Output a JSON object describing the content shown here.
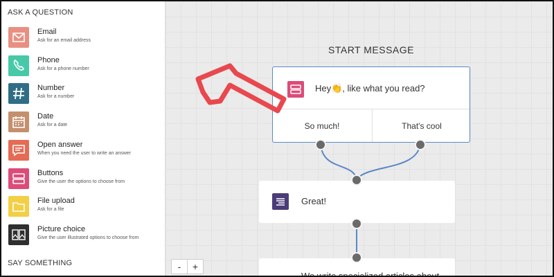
{
  "sidebar": {
    "section_ask": "ASK A QUESTION",
    "section_say": "SAY SOMETHING",
    "items": [
      {
        "title": "Email",
        "desc": "Ask for an email address",
        "icon": "envelope-icon",
        "color": "#e98f82"
      },
      {
        "title": "Phone",
        "desc": "Ask for a phone number",
        "icon": "phone-icon",
        "color": "#47c9a8"
      },
      {
        "title": "Number",
        "desc": "Ask for a number",
        "icon": "hash-icon",
        "color": "#2f6e86"
      },
      {
        "title": "Date",
        "desc": "Ask for a date",
        "icon": "calendar-icon",
        "color": "#c58f6e"
      },
      {
        "title": "Open answer",
        "desc": "When you need the user to write an answer",
        "icon": "chat-lines-icon",
        "color": "#e56b55"
      },
      {
        "title": "Buttons",
        "desc": "Give the user the options to choose from",
        "icon": "buttons-icon",
        "color": "#dc4c78"
      },
      {
        "title": "File upload",
        "desc": "Ask for a file",
        "icon": "folder-icon",
        "color": "#f3cf45"
      },
      {
        "title": "Picture choice",
        "desc": "Give the user illustrated options to choose from",
        "icon": "picture-icon",
        "color": "#2f2f2f"
      }
    ]
  },
  "canvas": {
    "start_label": "START MESSAGE",
    "start_message": "Hey👏, like what you read?",
    "options": [
      "So much!",
      "That's cool"
    ],
    "great_message": "Great!",
    "next_message": "We write specialized articles about",
    "zoom_out": "-",
    "zoom_in": "+"
  },
  "colors": {
    "accent_blue": "#5a87c8",
    "arrow_red": "#e8484e",
    "great_icon": "#4b3c78",
    "start_icon": "#dc4c78"
  }
}
